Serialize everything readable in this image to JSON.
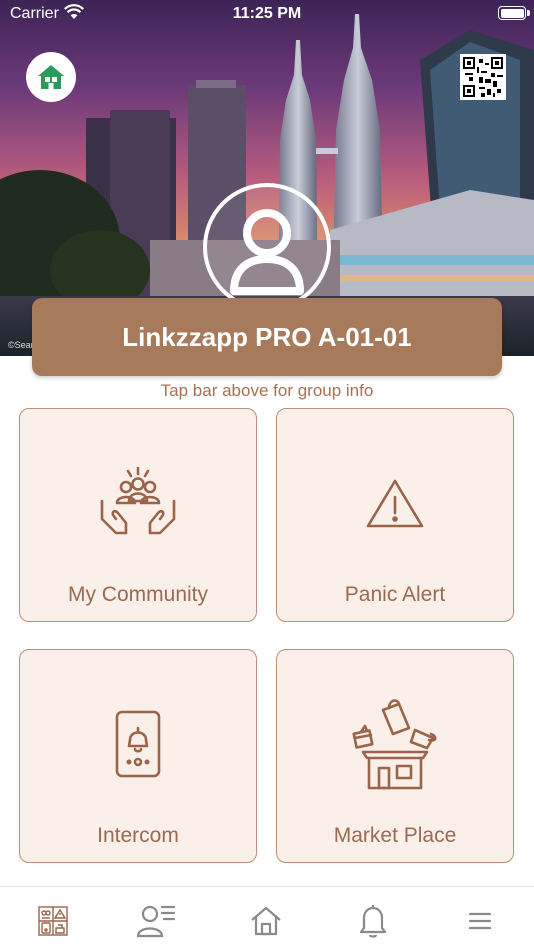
{
  "status_bar": {
    "carrier": "Carrier",
    "time": "11:25 PM"
  },
  "hero": {
    "photo_credit": "©Sean",
    "home_button_icon": "home-icon",
    "qr_button_icon": "qr-code-icon",
    "avatar_icon": "user-avatar-icon"
  },
  "group": {
    "name": "Linkzzapp PRO A-01-01",
    "hint": "Tap bar above for group info"
  },
  "tiles": [
    {
      "label": "My Community",
      "icon": "community-hands-icon"
    },
    {
      "label": "Panic Alert",
      "icon": "warning-triangle-icon"
    },
    {
      "label": "Intercom",
      "icon": "intercom-bell-icon"
    },
    {
      "label": "Market Place",
      "icon": "market-box-icon"
    }
  ],
  "tabbar": {
    "items": [
      {
        "icon": "dashboard-grid-icon",
        "active": true
      },
      {
        "icon": "contacts-list-icon",
        "active": false
      },
      {
        "icon": "home-icon",
        "active": false
      },
      {
        "icon": "bell-icon",
        "active": false
      },
      {
        "icon": "menu-icon",
        "active": false
      }
    ]
  },
  "colors": {
    "brand_brown": "#a87a5c",
    "tile_bg": "#fbefea",
    "tile_border": "#b98f77",
    "label_brown": "#996b52",
    "home_green": "#2e9a5a",
    "tab_gray": "#8a8a8a"
  }
}
